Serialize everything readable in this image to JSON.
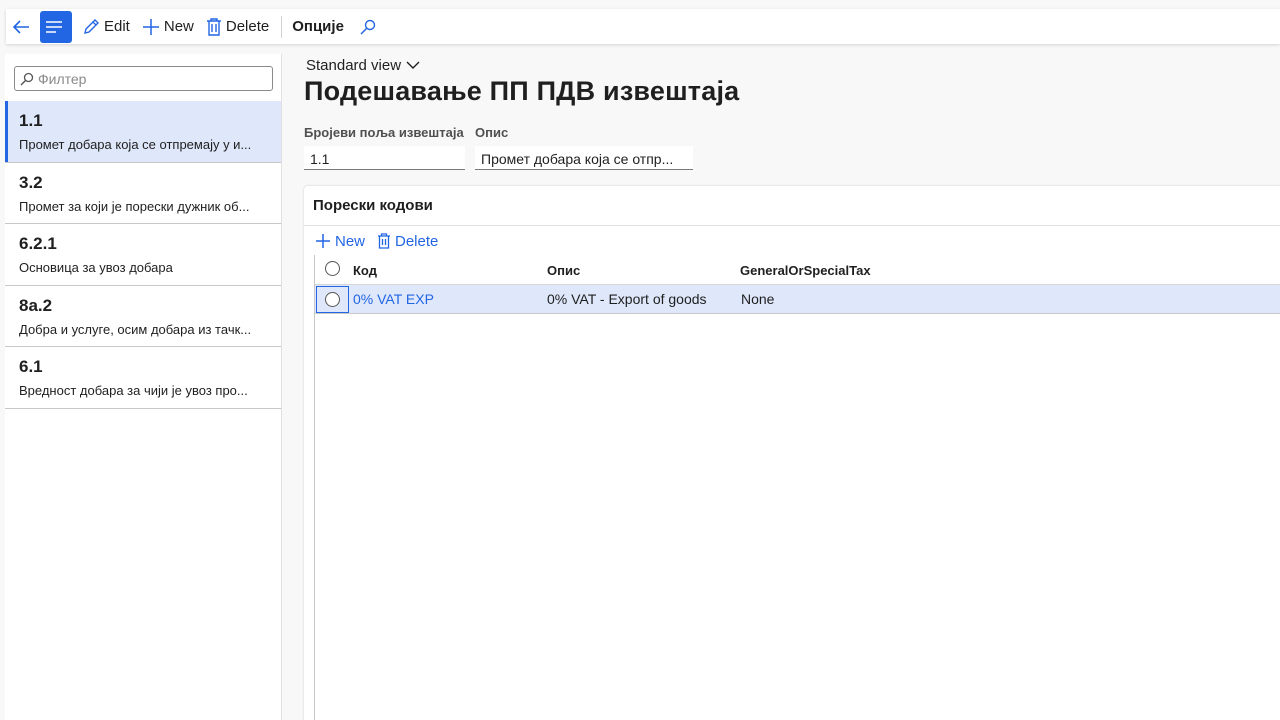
{
  "toolbar": {
    "edit_label": "Edit",
    "new_label": "New",
    "delete_label": "Delete",
    "options_label": "Опције"
  },
  "left_panel": {
    "filter_placeholder": "Филтер",
    "items": [
      {
        "code": "1.1",
        "description": "Промет добара која се отпремају у и...",
        "selected": true
      },
      {
        "code": "3.2",
        "description": "Промет за који је порески дужник об..."
      },
      {
        "code": "6.2.1",
        "description": "Основица за увоз добара"
      },
      {
        "code": "8а.2",
        "description": "Добра и услуге, осим добара из тачк..."
      },
      {
        "code": "6.1",
        "description": "Вредност добара за чији је увоз про..."
      }
    ]
  },
  "main": {
    "view_label": "Standard view",
    "title": "Подешавање ПП ПДВ извештаја",
    "fields": {
      "number_label": "Бројеви поља извештаја",
      "number_value": "1.1",
      "description_label": "Опис",
      "description_value": "Промет добара која се отпр..."
    },
    "tax_codes": {
      "title": "Порески кодови",
      "new_label": "New",
      "delete_label": "Delete",
      "columns": [
        "Код",
        "Опис",
        "GeneralOrSpecialTax"
      ],
      "rows": [
        {
          "code": "0% VAT EXP",
          "description": "0% VAT - Export of goods",
          "type": "None"
        }
      ]
    }
  },
  "colors": {
    "accent": "#2266e3",
    "selected_bg": "#dfe7fb"
  }
}
